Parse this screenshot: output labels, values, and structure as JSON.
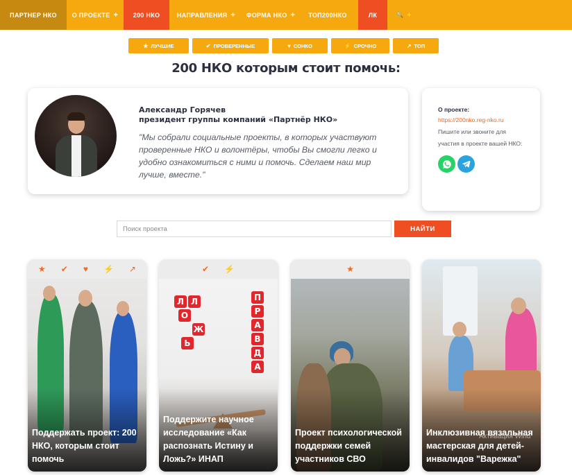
{
  "nav": {
    "brand": "ПАРТНЕР НКО",
    "about": "О ПРОЕКТЕ",
    "nko200": "200 НКО",
    "directions": "НАПРАВЛЕНИЯ",
    "form": "ФОРМА НКО",
    "top": "ТОП200НКО",
    "lk": "ЛК",
    "plus": "+",
    "search_glyph": "🔍"
  },
  "filters": [
    {
      "icon": "★",
      "label": "ЛУЧШИЕ"
    },
    {
      "icon": "✔",
      "label": "ПРОВЕРЕННЫЕ"
    },
    {
      "icon": "♥",
      "label": "СОНКО"
    },
    {
      "icon": "⚡",
      "label": "СРОЧНО"
    },
    {
      "icon": "↗",
      "label": "ТОП"
    }
  ],
  "page_title": "200 НКО которым стоит помочь:",
  "quote": {
    "name": "Александр Горячев",
    "position": "президент группы компаний «Партнёр НКО»",
    "text": "\"Мы собрали социальные проекты, в которых участвуют проверенные НКО и волонтёры, чтобы Вы смогли легко и удобно ознакомиться с ними и помочь. Сделаем наш мир лучше, вместе.\""
  },
  "about": {
    "title": "О проекте:",
    "link": "https://200nko.reg-nko.ru",
    "text": "Пишите или звоните для участия в проекте вашей НКО:"
  },
  "search": {
    "placeholder": "Поиск проекта",
    "button": "НАЙТИ"
  },
  "cards": [
    {
      "title": "Поддержать проект: 200 НКО, которым стоит помочь",
      "icons": [
        "★",
        "✔",
        "♥",
        "⚡",
        "↗"
      ]
    },
    {
      "title": "Поддержите научное исследование «Как распознать Истину и Ложь?» ИНАП",
      "icons": [
        "✔",
        "⚡"
      ]
    },
    {
      "title": "Проект психологической поддержки семей участников СВО",
      "icons": [
        "★"
      ]
    },
    {
      "title": "Инклюзивная вязальная мастерская для детей-инвалидов \"Варежка\"",
      "icons": []
    }
  ],
  "card2_blocks": {
    "left": [
      "Л",
      "Л",
      "О",
      "Ж",
      "Ь"
    ],
    "right": [
      "П",
      "Р",
      "А",
      "В",
      "Д",
      "А"
    ]
  },
  "watermark": "Активация Wind",
  "colors": {
    "accent": "#f5a90f",
    "accent_dark": "#c78a10",
    "highlight": "#ef4e23",
    "text_dark": "#2b2f3f"
  }
}
